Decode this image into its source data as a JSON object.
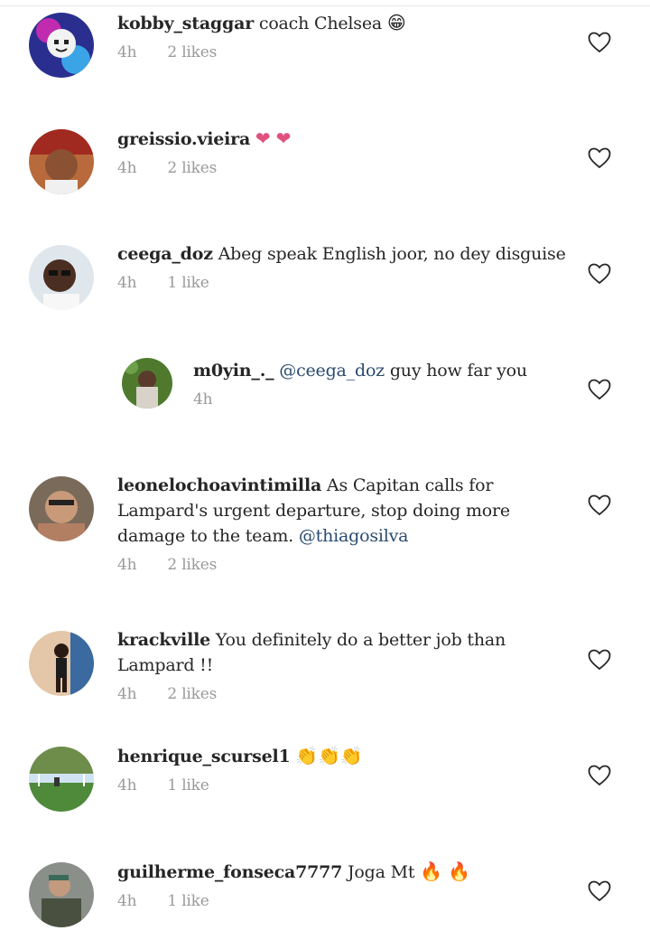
{
  "comments": [
    {
      "username": "kobby_staggar",
      "text": "coach Chelsea",
      "emoji": "😁",
      "time": "4h",
      "likes": "2 likes"
    },
    {
      "username": "greissio.vieira",
      "text": "",
      "emoji": "❤ ❤",
      "time": "4h",
      "likes": "2 likes"
    },
    {
      "username": "ceega_doz",
      "text": "Abeg speak English joor, no dey disguise",
      "emoji": "",
      "time": "4h",
      "likes": "1 like"
    },
    {
      "username": "m0yin_._",
      "mention": "@ceega_doz",
      "text": "guy how far you",
      "time": "4h",
      "likes": ""
    },
    {
      "username": "leonelochoavintimilla",
      "text": "As Capitan calls for Lampard's urgent departure, stop doing more damage to the team.",
      "mention": "@thiagosilva",
      "time": "4h",
      "likes": "2 likes"
    },
    {
      "username": "krackville",
      "text": "You definitely do a better job than Lampard !!",
      "emoji": "",
      "time": "4h",
      "likes": "2 likes"
    },
    {
      "username": "henrique_scursel1",
      "text": "",
      "emoji": "👏👏👏",
      "time": "4h",
      "likes": "1 like"
    },
    {
      "username": "guilherme_fonseca7777",
      "text": "Joga Mt",
      "emoji": "🔥 🔥",
      "time": "4h",
      "likes": "1 like"
    }
  ],
  "icons": {
    "like": "heart-outline-icon"
  },
  "colors": {
    "mention": "#2b4a6f",
    "meta": "#9a9a9a",
    "heart": "#262626",
    "emoji_heart": "#e0517e"
  }
}
